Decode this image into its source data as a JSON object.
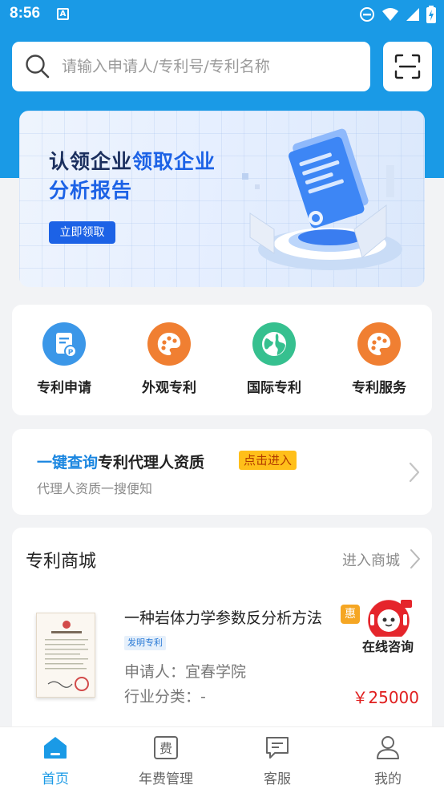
{
  "status_bar": {
    "time": "8:56",
    "notification_icon": "A"
  },
  "search": {
    "placeholder": "请输入申请人/专利号/专利名称"
  },
  "banner": {
    "title_part1": "认领企业",
    "title_part2": "领取企业",
    "title_line2": "分析报告",
    "button_label": "立即领取"
  },
  "quick_actions": [
    {
      "label": "专利申请",
      "icon": "document-p-icon",
      "color": "#3b97e8"
    },
    {
      "label": "外观专利",
      "icon": "palette-icon",
      "color": "#f07f32"
    },
    {
      "label": "国际专利",
      "icon": "globe-icon",
      "color": "#36c08f"
    },
    {
      "label": "专利服务",
      "icon": "palette-icon",
      "color": "#f07f32"
    }
  ],
  "agent_card": {
    "highlight": "一键查询",
    "title": "专利代理人资质",
    "badge": "点击进入",
    "subtitle": "代理人资质一搜便知"
  },
  "mall": {
    "title": "专利商城",
    "enter_label": "进入商城",
    "product": {
      "title": "一种岩体力学参数反分析方法",
      "discount_badge": "惠",
      "type_tag": "发明专利",
      "applicant": "申请人：宜春学院",
      "industry": "行业分类：-",
      "price": "￥25000"
    }
  },
  "online_consult": {
    "label": "在线咨询"
  },
  "tabs": [
    {
      "label": "首页",
      "icon": "home-icon",
      "active": true
    },
    {
      "label": "年费管理",
      "icon": "fee-icon",
      "active": false
    },
    {
      "label": "客服",
      "icon": "chat-icon",
      "active": false
    },
    {
      "label": "我的",
      "icon": "user-icon",
      "active": false
    }
  ],
  "colors": {
    "primary": "#1a9ae6",
    "price": "#e02020",
    "badge": "#ffbf1a"
  }
}
